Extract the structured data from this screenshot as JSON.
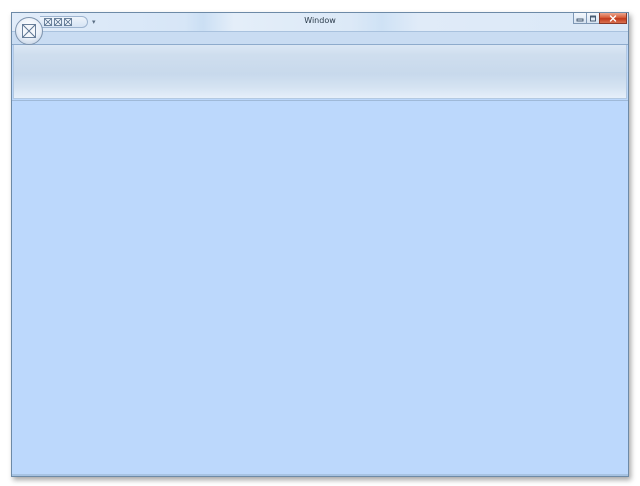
{
  "window": {
    "title": "Window"
  },
  "app_button": {
    "icon": "envelope-icon"
  },
  "quick_access_toolbar": {
    "buttons": [
      {
        "icon": "placeholder-icon"
      },
      {
        "icon": "placeholder-icon"
      },
      {
        "icon": "placeholder-icon"
      }
    ],
    "customize_glyph": "▾"
  },
  "caption_buttons": {
    "minimize": "minimize-icon",
    "maximize": "maximize-icon",
    "close": "close-icon"
  },
  "colors": {
    "workspace": "#bcd8fc",
    "border": "#6d8aa7",
    "close_button": "#c0391b"
  }
}
